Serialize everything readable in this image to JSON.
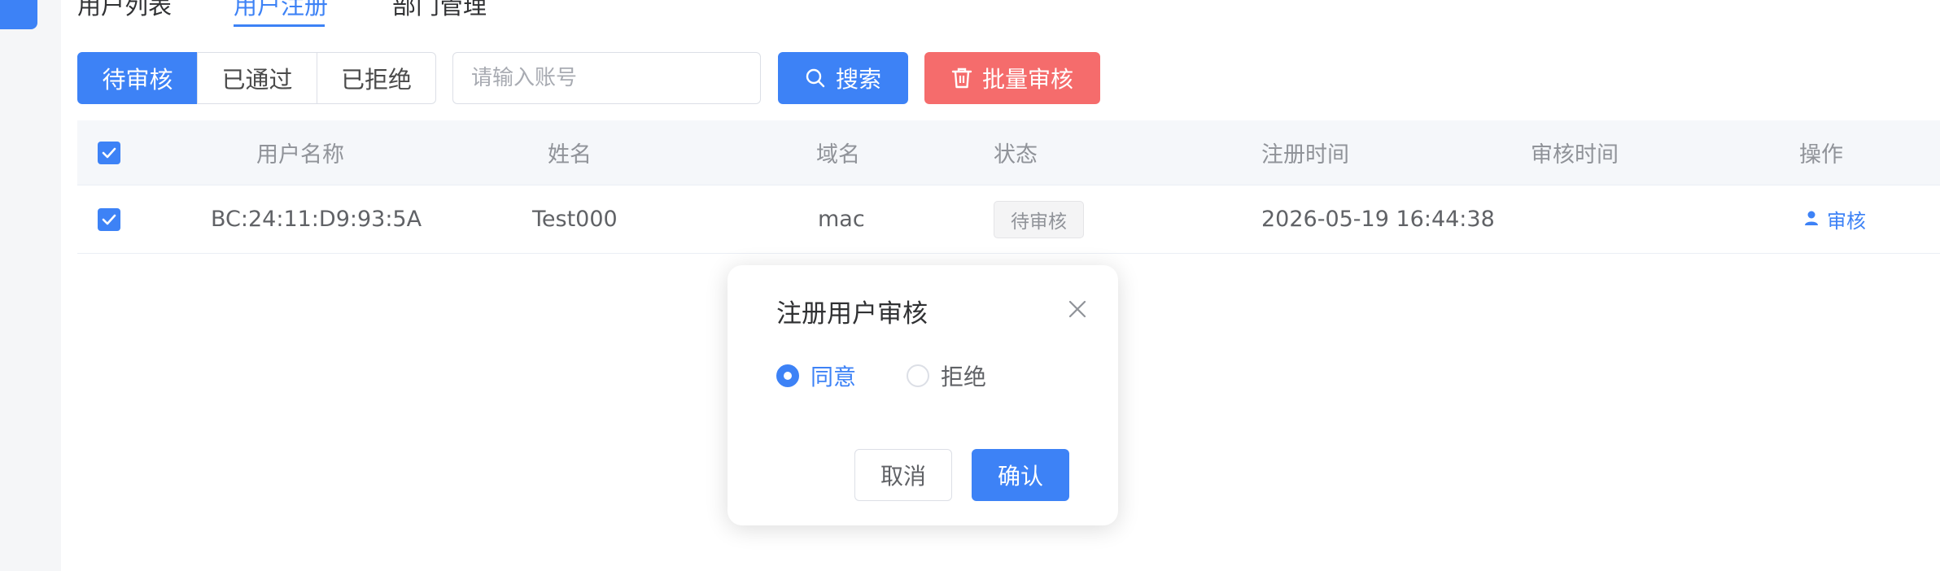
{
  "tabs": [
    {
      "label": "用户列表"
    },
    {
      "label": "用户注册"
    },
    {
      "label": "部门管理"
    }
  ],
  "filters": {
    "options": [
      {
        "label": "待审核"
      },
      {
        "label": "已通过"
      },
      {
        "label": "已拒绝"
      }
    ],
    "selected": "待审核"
  },
  "search": {
    "placeholder": "请输入账号",
    "value": "",
    "button_label": "搜索",
    "button_icon": "search-icon"
  },
  "batch": {
    "label": "批量审核",
    "icon": "trash-icon"
  },
  "table": {
    "columns": [
      "用户名称",
      "姓名",
      "域名",
      "状态",
      "注册时间",
      "审核时间",
      "操作"
    ],
    "rows": [
      {
        "checked": true,
        "username": "BC:24:11:D9:93:5A",
        "name": "Test000",
        "domain": "mac",
        "status": "待审核",
        "register_time": "2026-05-19 16:44:38",
        "review_time": "",
        "action_label": "审核",
        "action_icon": "user-icon"
      }
    ]
  },
  "dialog": {
    "title": "注册用户审核",
    "options": [
      {
        "label": "同意",
        "selected": true
      },
      {
        "label": "拒绝",
        "selected": false
      }
    ],
    "cancel_label": "取消",
    "confirm_label": "确认"
  },
  "colors": {
    "primary": "#3d82f6",
    "danger": "#f56c6c"
  }
}
